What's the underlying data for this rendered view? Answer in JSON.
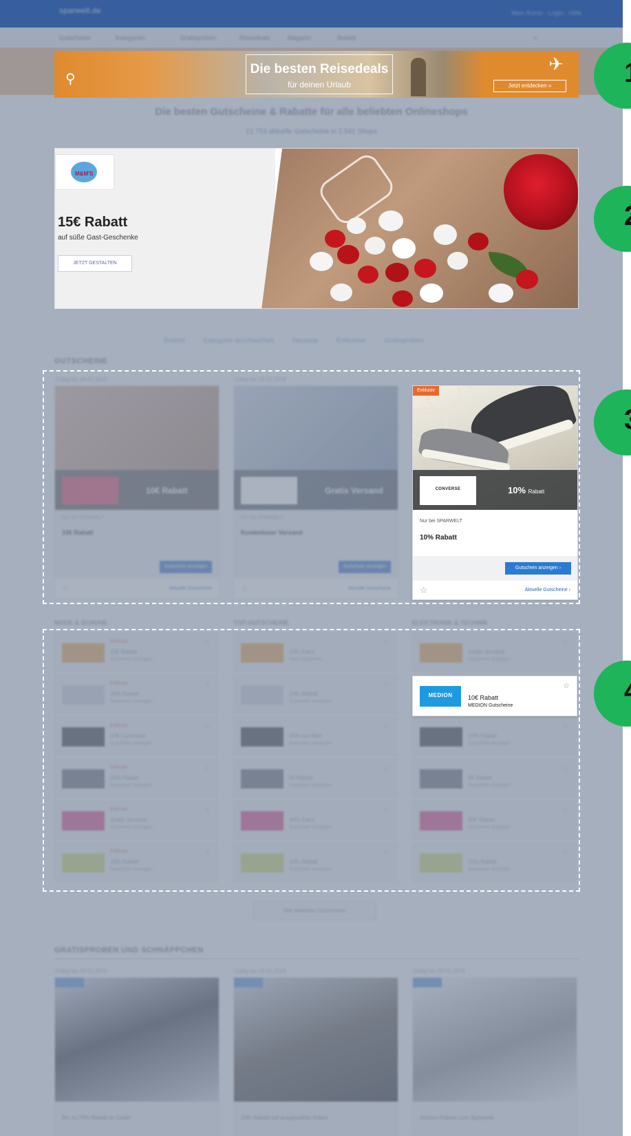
{
  "header": {
    "logo": "sparwelt.de",
    "links": "Mein Konto · Login · Hilfe"
  },
  "subnav": {
    "items": [
      "Gutscheine",
      "Kategorien",
      "Gratisproben",
      "Reisedeals",
      "Magazin",
      "Beliebt"
    ]
  },
  "travel_banner": {
    "title": "Die besten Reisedeals",
    "subtitle": "für deinen Urlaub",
    "cta": "Jetzt entdecken »",
    "pin_icon": "map-pin-icon",
    "plane_icon": "airplane-icon"
  },
  "hero": {
    "title": "Die besten Gutscheine & Rabatte für alle beliebten Onlineshops",
    "subtitle": "21.753 aktuelle Gutscheine in 2.541 Shops"
  },
  "promo_banner": {
    "logo_text": "M&M'S",
    "title": "15€ Rabatt",
    "subtitle": "auf süße Gast-Geschenke",
    "button": "JETZT GESTALTEN"
  },
  "tabs": [
    "Beliebt",
    "Kategorie durchsuchen",
    "Neueste",
    "Exklusive",
    "Gratisproben"
  ],
  "coupons": {
    "section_title": "GUTSCHEINE",
    "cards": [
      {
        "label": "Gültig bis 28.02.2019",
        "badge": "",
        "discount": "10€ Rabatt",
        "small": "Nur bei SPARWELT",
        "title": "10€ Rabatt",
        "button": "Gutschein anzeigen",
        "link": "Aktuelle Gutscheine"
      },
      {
        "label": "Gültig bis 28.02.2019",
        "badge": "",
        "discount": "Gratis Versand",
        "small": "Nur bei SPARWELT",
        "title": "Kostenloser Versand",
        "button": "Gutschein anzeigen",
        "link": "Aktuelle Gutscheine"
      },
      {
        "label": "Gültig bis 28.02.2019",
        "badge": "Exklusiv",
        "logo": "CONVERSE",
        "discount": "10%",
        "discount_unit": "Rabatt",
        "small": "Nur bei SPARWELT",
        "title": "10% Rabatt",
        "button": "Gutschein anzeigen ›",
        "link": "Aktuelle Gutscheine ›"
      }
    ]
  },
  "shop_columns": {
    "headings": [
      "MODE & SCHUHE",
      "TOP-GUTSCHEINE",
      "ELEKTRONIK & TECHNIK"
    ],
    "rows": [
      [
        {
          "t1": "Exklusiv",
          "t2": "15€ Rabatt",
          "t3": "Gutschein anzeigen"
        },
        {
          "t1": "Exklusiv",
          "t2": "20% Rabatt",
          "t3": "Gutschein anzeigen"
        },
        {
          "t1": "Exklusiv",
          "t2": "10€ Gutschein",
          "t3": "Gutschein anzeigen"
        },
        {
          "t1": "Exklusiv",
          "t2": "20% Rabatt",
          "t3": "Gutschein anzeigen"
        },
        {
          "t1": "Exklusiv",
          "t2": "Gratis Versand",
          "t3": "Gutschein anzeigen"
        },
        {
          "t1": "Exklusiv",
          "t2": "10% Rabatt",
          "t3": "Gutschein anzeigen"
        }
      ],
      [
        {
          "t1": "",
          "t2": "10% Extra",
          "t3": "Nike Gutschein"
        },
        {
          "t1": "",
          "t2": "20% Rabatt",
          "t3": "Gutschein anzeigen"
        },
        {
          "t1": "",
          "t2": "15% auf Alles",
          "t3": "Gutschein anzeigen"
        },
        {
          "t1": "",
          "t2": "5€ Rabatt",
          "t3": "Gutschein anzeigen"
        },
        {
          "t1": "",
          "t2": "30% Extra",
          "t3": "Gutschein anzeigen"
        },
        {
          "t1": "",
          "t2": "10% Rabatt",
          "t3": "Gutschein anzeigen"
        }
      ],
      [
        {
          "t1": "",
          "t2": "Gratis Versand",
          "t3": "Gutschein anzeigen"
        },
        {
          "t1": "",
          "t2": "10€ Rabatt",
          "t3": "MEDION Gutscheine",
          "logo": "MEDION"
        },
        {
          "t1": "",
          "t2": "10% Rabatt",
          "t3": "Gutschein anzeigen"
        },
        {
          "t1": "",
          "t2": "5€ Rabatt",
          "t3": "Gutschein anzeigen"
        },
        {
          "t1": "",
          "t2": "20€ Rabatt",
          "t3": "Gutschein anzeigen"
        },
        {
          "t1": "",
          "t2": "15% Rabatt",
          "t3": "Gutschein anzeigen"
        }
      ]
    ]
  },
  "more_button": "Alle beliebten Gutscheine",
  "deals": {
    "section_title": "GRATISPROBEN UND SCHNÄPPCHEN",
    "items": [
      {
        "label": "Gültig bis 28.02.2019",
        "text": "Bis zu 70% Rabatt im Outlet"
      },
      {
        "label": "Gültig bis 28.02.2019",
        "text": "20% Rabatt auf ausgewählte Artikel"
      },
      {
        "label": "Gültig bis 28.02.2019",
        "text": "Socken-Pakete zum Sparpreis"
      }
    ]
  },
  "markers": [
    "1",
    "2",
    "3",
    "4"
  ],
  "colors": {
    "header": "#3b6fc0",
    "marker": "#1db45a",
    "button": "#2b7bd0",
    "medion": "#1e9be0",
    "exclusive_badge": "#e8692d"
  }
}
